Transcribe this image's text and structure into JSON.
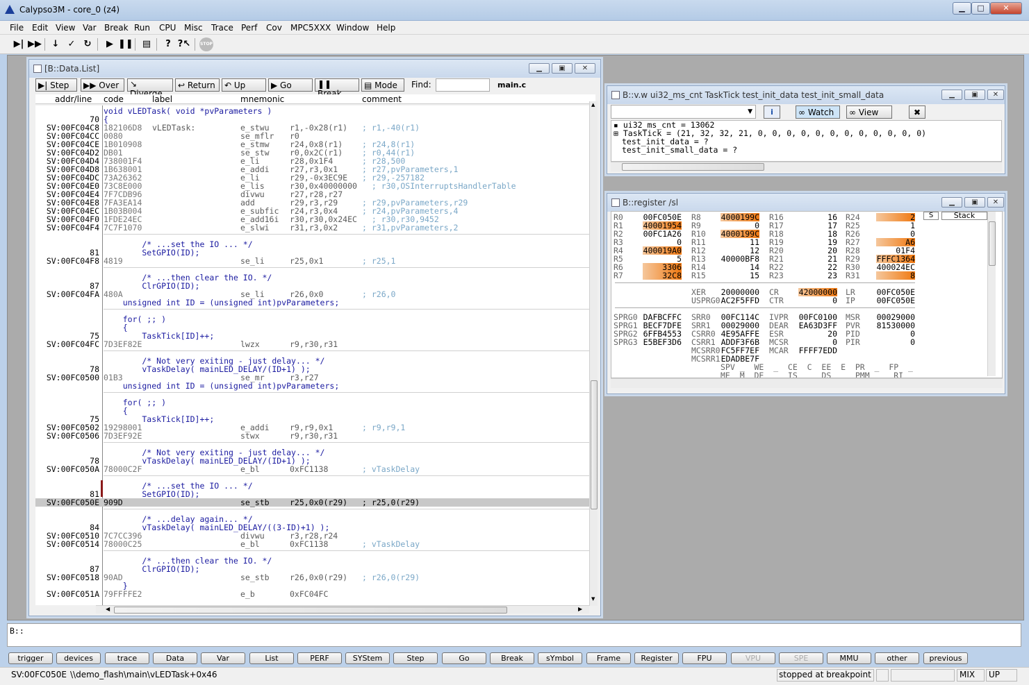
{
  "app": {
    "title": "Calypso3M - core_0 (z4)"
  },
  "menu": [
    "File",
    "Edit",
    "View",
    "Var",
    "Break",
    "Run",
    "CPU",
    "Misc",
    "Trace",
    "Perf",
    "Cov",
    "MPC5XXX",
    "Window",
    "Help"
  ],
  "toolbar_icons": [
    "step-into-icon",
    "step-over-icon",
    "down-arrow-icon",
    "checkmark-icon",
    "return-icon",
    "go-icon",
    "pause-icon",
    "list-icon",
    "help-icon",
    "context-help-icon",
    "stop-icon"
  ],
  "datalist": {
    "title": "[B::Data.List]",
    "buttons": [
      "Step",
      "Over",
      "Diverge",
      "Return",
      "Up",
      "Go",
      "Break",
      "Mode"
    ],
    "find_label": "Find:",
    "find_value": "",
    "file": "main.c",
    "headers": {
      "addr": "addr/line",
      "code": "code",
      "label": "label",
      "mnemonic": "mnemonic",
      "comment": "comment"
    },
    "rows": [
      {
        "t": "src",
        "s": "void vLEDTask( void *pvParameters )"
      },
      {
        "t": "src",
        "a": "70",
        "s": "{"
      },
      {
        "t": "asm",
        "a": "SV:00FC04C8",
        "c": "182106D8",
        "l": "vLEDTask:",
        "m": "e_stwu",
        "o": "r1,-0x28(r1)",
        "k": "; r1,-40(r1)"
      },
      {
        "t": "asm",
        "a": "SV:00FC04CC",
        "c": "0080",
        "m": "se_mflr",
        "o": "r0"
      },
      {
        "t": "asm",
        "a": "SV:00FC04CE",
        "c": "1B010908",
        "m": "e_stmw",
        "o": "r24,0x8(r1)",
        "k": "; r24,8(r1)"
      },
      {
        "t": "asm",
        "a": "SV:00FC04D2",
        "c": "DB01",
        "m": "se_stw",
        "o": "r0,0x2C(r1)",
        "k": "; r0,44(r1)"
      },
      {
        "t": "asm",
        "a": "SV:00FC04D4",
        "c": "738001F4",
        "m": "e_li",
        "o": "r28,0x1F4",
        "k": "; r28,500"
      },
      {
        "t": "asm",
        "a": "SV:00FC04D8",
        "c": "1B638001",
        "m": "e_addi",
        "o": "r27,r3,0x1",
        "k": "; r27,pvParameters,1"
      },
      {
        "t": "asm",
        "a": "SV:00FC04DC",
        "c": "73A26362",
        "m": "e_li",
        "o": "r29,-0x3EC9E",
        "k": "; r29,-257182"
      },
      {
        "t": "asm",
        "a": "SV:00FC04E0",
        "c": "73C8E000",
        "m": "e_lis",
        "o": "r30,0x40000000",
        "k": "  ; r30,OSInterruptsHandlerTable"
      },
      {
        "t": "asm",
        "a": "SV:00FC04E4",
        "c": "7F7CDB96",
        "m": "divwu",
        "o": "r27,r28,r27"
      },
      {
        "t": "asm",
        "a": "SV:00FC04E8",
        "c": "7FA3EA14",
        "m": "add",
        "o": "r29,r3,r29",
        "k": "; r29,pvParameters,r29"
      },
      {
        "t": "asm",
        "a": "SV:00FC04EC",
        "c": "1B03B004",
        "m": "e_subfic",
        "o": "r24,r3,0x4",
        "k": "; r24,pvParameters,4"
      },
      {
        "t": "asm",
        "a": "SV:00FC04F0",
        "c": "1FDE24EC",
        "m": "e_add16i",
        "o": "r30,r30,0x24EC",
        "k": "  ; r30,r30,9452"
      },
      {
        "t": "asm",
        "a": "SV:00FC04F4",
        "c": "7C7F1070",
        "m": "e_slwi",
        "o": "r31,r3,0x2",
        "k": "; r31,pvParameters,2"
      },
      {
        "t": "sep"
      },
      {
        "t": "src",
        "s": "        /* ...set the IO ... */"
      },
      {
        "t": "src",
        "a": "81",
        "s": "        SetGPIO(ID);"
      },
      {
        "t": "asm",
        "a": "SV:00FC04F8",
        "c": "4819",
        "m": "se_li",
        "o": "r25,0x1",
        "k": "; r25,1"
      },
      {
        "t": "sep"
      },
      {
        "t": "src",
        "s": "        /* ...then clear the IO. */"
      },
      {
        "t": "src",
        "a": "87",
        "s": "        ClrGPIO(ID);"
      },
      {
        "t": "asm",
        "a": "SV:00FC04FA",
        "c": "480A",
        "m": "se_li",
        "o": "r26,0x0",
        "k": "; r26,0"
      },
      {
        "t": "src",
        "s": "    unsigned int ID = (unsigned int)pvParameters;"
      },
      {
        "t": "sep"
      },
      {
        "t": "src",
        "s": "    for( ;; )"
      },
      {
        "t": "src",
        "s": "    {"
      },
      {
        "t": "src",
        "a": "75",
        "s": "        TaskTick[ID]++;"
      },
      {
        "t": "asm",
        "a": "SV:00FC04FC",
        "c": "7D3EF82E",
        "m": "lwzx",
        "o": "r9,r30,r31"
      },
      {
        "t": "sep"
      },
      {
        "t": "src",
        "s": "        /* Not very exiting - just delay... */"
      },
      {
        "t": "src",
        "a": "78",
        "s": "        vTaskDelay( mainLED_DELAY/(ID+1) );"
      },
      {
        "t": "asm",
        "a": "SV:00FC0500",
        "c": "01B3",
        "m": "se_mr",
        "o": "r3,r27"
      },
      {
        "t": "src",
        "s": "    unsigned int ID = (unsigned int)pvParameters;"
      },
      {
        "t": "sep"
      },
      {
        "t": "src",
        "s": "    for( ;; )"
      },
      {
        "t": "src",
        "s": "    {"
      },
      {
        "t": "src",
        "a": "75",
        "s": "        TaskTick[ID]++;"
      },
      {
        "t": "asm",
        "a": "SV:00FC0502",
        "c": "19298001",
        "m": "e_addi",
        "o": "r9,r9,0x1",
        "k": "; r9,r9,1"
      },
      {
        "t": "asm",
        "a": "SV:00FC0506",
        "c": "7D3EF92E",
        "m": "stwx",
        "o": "r9,r30,r31"
      },
      {
        "t": "sep"
      },
      {
        "t": "src",
        "s": "        /* Not very exiting - just delay... */"
      },
      {
        "t": "src",
        "a": "78",
        "s": "        vTaskDelay( mainLED_DELAY/(ID+1) );"
      },
      {
        "t": "asm",
        "a": "SV:00FC050A",
        "c": "78000C2F",
        "m": "e_bl",
        "o": "0xFC1138",
        "k": "; vTaskDelay"
      },
      {
        "t": "sep"
      },
      {
        "t": "src",
        "s": "        /* ...set the IO ... */"
      },
      {
        "t": "src",
        "a": "81",
        "s": "        SetGPIO(ID);"
      },
      {
        "t": "asm",
        "hl": true,
        "a": "SV:00FC050E",
        "c": "909D",
        "m": "se_stb",
        "o": "r25,0x0(r29)",
        "k": "; r25,0(r29)"
      },
      {
        "t": "sep"
      },
      {
        "t": "src",
        "s": "        /* ...delay again... */"
      },
      {
        "t": "src",
        "a": "84",
        "s": "        vTaskDelay( mainLED_DELAY/((3-ID)+1) );"
      },
      {
        "t": "asm",
        "a": "SV:00FC0510",
        "c": "7C7CC396",
        "m": "divwu",
        "o": "r3,r28,r24"
      },
      {
        "t": "asm",
        "a": "SV:00FC0514",
        "c": "78000C25",
        "m": "e_bl",
        "o": "0xFC1138",
        "k": "; vTaskDelay"
      },
      {
        "t": "sep"
      },
      {
        "t": "src",
        "s": "        /* ...then clear the IO. */"
      },
      {
        "t": "src",
        "a": "87",
        "s": "        ClrGPIO(ID);"
      },
      {
        "t": "asm",
        "a": "SV:00FC0518",
        "c": "90AD",
        "m": "se_stb",
        "o": "r26,0x0(r29)",
        "k": "; r26,0(r29)"
      },
      {
        "t": "src",
        "s": "    }"
      },
      {
        "t": "asm",
        "a": "SV:00FC051A",
        "c": "79FFFFE2",
        "m": "e_b",
        "o": "0xFC04FC"
      }
    ]
  },
  "varwatch": {
    "title": "B::v.w ui32_ms_cnt TaskTick  test_init_data  test_init_small_data",
    "buttons": {
      "watch": "Watch",
      "view": "View"
    },
    "lines": [
      "ui32_ms_cnt = 13062",
      "TaskTick = (21, 32, 32, 21, 0, 0, 0, 0, 0, 0, 0, 0, 0, 0, 0, 0)",
      "test_init_data = ?",
      "test_init_small_data = ?"
    ]
  },
  "register": {
    "title": "B::register /sl",
    "stack_labels": [
      "S",
      "Stack"
    ],
    "regs": [
      [
        "R0",
        "00FC050E",
        false,
        "R8",
        "4000199C",
        true,
        "R16",
        "16",
        false,
        "R24",
        "2",
        true
      ],
      [
        "R1",
        "40001954",
        true,
        "R9",
        "0",
        false,
        "R17",
        "17",
        false,
        "R25",
        "1",
        false
      ],
      [
        "R2",
        "00FC1A26",
        false,
        "R10",
        "4000199C",
        true,
        "R18",
        "18",
        false,
        "R26",
        "0",
        false
      ],
      [
        "R3",
        "0",
        false,
        "R11",
        "11",
        false,
        "R19",
        "19",
        false,
        "R27",
        "A6",
        true
      ],
      [
        "R4",
        "400019A0",
        true,
        "R12",
        "12",
        false,
        "R20",
        "20",
        false,
        "R28",
        "01F4",
        false
      ],
      [
        "R5",
        "5",
        false,
        "R13",
        "40000BF8",
        false,
        "R21",
        "21",
        false,
        "R29",
        "FFFC1364",
        true
      ],
      [
        "R6",
        "3306",
        true,
        "R14",
        "14",
        false,
        "R22",
        "22",
        false,
        "R30",
        "400024EC",
        false
      ],
      [
        "R7",
        "32C8",
        true,
        "R15",
        "15",
        false,
        "R23",
        "23",
        false,
        "R31",
        "8",
        true
      ]
    ],
    "special": [
      [
        "XER",
        "20000000",
        "CR",
        "42000000",
        "LR",
        "00FC050E"
      ],
      [
        "USPRG0",
        "AC2F5FFD",
        "CTR",
        "0",
        "IP",
        "00FC050E"
      ]
    ],
    "spr": [
      [
        "SPRG0",
        "DAFBCFFC",
        "SRR0",
        "00FC114C",
        "IVPR",
        "00FC0100",
        "MSR",
        "00029000"
      ],
      [
        "SPRG1",
        "BECF7DFE",
        "SRR1",
        "00029000",
        "DEAR",
        "EA63D3FF",
        "PVR",
        "81530000"
      ],
      [
        "SPRG2",
        "6FFB4553",
        "CSRR0",
        "4E95AFFE",
        "ESR",
        "20",
        "PID",
        "0"
      ],
      [
        "SPRG3",
        "E5BEF3D6",
        "CSRR1",
        "ADDF3F6B",
        "MCSR",
        "0",
        "PIR",
        "0"
      ],
      [
        "",
        "",
        "MCSRR0",
        "FC5FF7EF",
        "MCAR",
        "FFFF7EDD",
        "",
        ""
      ],
      [
        "",
        "",
        "MCSRR1",
        "EDADBE7F",
        "",
        "",
        "",
        ""
      ]
    ],
    "flags1": "SPV _  WE  _  CE  C  EE  E  PR  _  FP  _",
    "flags2": "ME  M  DE  _  IS  _  DS  _  PMM  _  RI  _"
  },
  "cmdline": {
    "value": "B::"
  },
  "bottom_buttons": [
    {
      "label": "trigger",
      "dis": false
    },
    {
      "label": "devices",
      "dis": false
    },
    {
      "label": "trace",
      "dis": false
    },
    {
      "label": "Data",
      "dis": false
    },
    {
      "label": "Var",
      "dis": false
    },
    {
      "label": "List",
      "dis": false
    },
    {
      "label": "PERF",
      "dis": false
    },
    {
      "label": "SYStem",
      "dis": false
    },
    {
      "label": "Step",
      "dis": false
    },
    {
      "label": "Go",
      "dis": false
    },
    {
      "label": "Break",
      "dis": false
    },
    {
      "label": "sYmbol",
      "dis": false
    },
    {
      "label": "Frame",
      "dis": false
    },
    {
      "label": "Register",
      "dis": false
    },
    {
      "label": "FPU",
      "dis": false
    },
    {
      "label": "VPU",
      "dis": true
    },
    {
      "label": "SPE",
      "dis": true
    },
    {
      "label": "MMU",
      "dis": false
    },
    {
      "label": "other",
      "dis": false
    },
    {
      "label": "previous",
      "dis": false
    }
  ],
  "status": {
    "address": "SV:00FC050E",
    "path": "\\\\demo_flash\\main\\vLEDTask+0x46",
    "state": "stopped at breakpoint",
    "mode": "MIX",
    "dir": "UP"
  }
}
